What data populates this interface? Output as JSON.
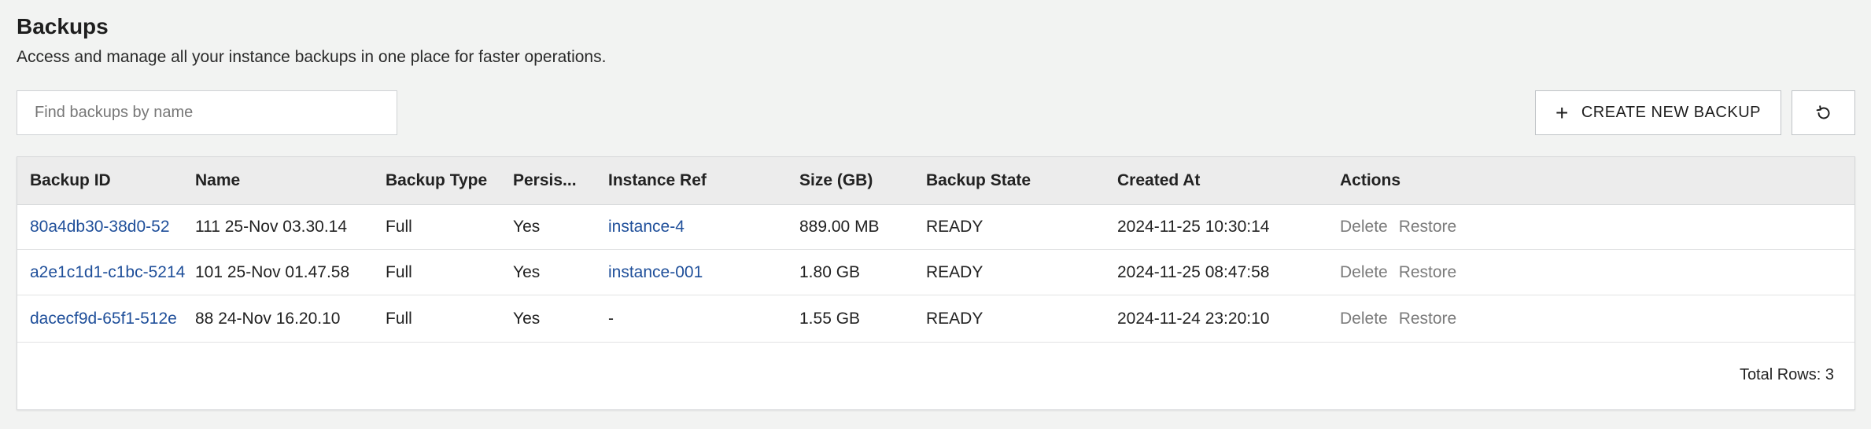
{
  "header": {
    "title": "Backups",
    "subtitle": "Access and manage all your instance backups in one place for faster operations."
  },
  "search": {
    "placeholder": "Find backups by name",
    "value": ""
  },
  "toolbar": {
    "create_label": "CREATE NEW BACKUP",
    "create_icon": "plus-icon",
    "refresh_icon": "refresh-icon"
  },
  "table": {
    "columns": [
      "Backup ID",
      "Name",
      "Backup Type",
      "Persis...",
      "Instance Ref",
      "Size (GB)",
      "Backup State",
      "Created At",
      "Actions"
    ],
    "rows": [
      {
        "backup_id": "80a4db30-38d0-52",
        "name": "111 25-Nov 03.30.14",
        "type": "Full",
        "persistent": "Yes",
        "instance_ref": "instance-4",
        "size": "889.00 MB",
        "state": "READY",
        "created_at": "2024-11-25 10:30:14",
        "action_delete": "Delete",
        "action_restore": "Restore"
      },
      {
        "backup_id": "a2e1c1d1-c1bc-5214",
        "name": "101 25-Nov 01.47.58",
        "type": "Full",
        "persistent": "Yes",
        "instance_ref": "instance-001",
        "size": "1.80 GB",
        "state": "READY",
        "created_at": "2024-11-25 08:47:58",
        "action_delete": "Delete",
        "action_restore": "Restore"
      },
      {
        "backup_id": "dacecf9d-65f1-512e",
        "name": "88 24-Nov 16.20.10",
        "type": "Full",
        "persistent": "Yes",
        "instance_ref": "-",
        "size": "1.55 GB",
        "state": "READY",
        "created_at": "2024-11-24 23:20:10",
        "action_delete": "Delete",
        "action_restore": "Restore"
      }
    ],
    "footer": "Total Rows: 3"
  },
  "colors": {
    "link": "#1f4f9a",
    "action": "#7b7b7b",
    "background": "#f2f3f2"
  }
}
